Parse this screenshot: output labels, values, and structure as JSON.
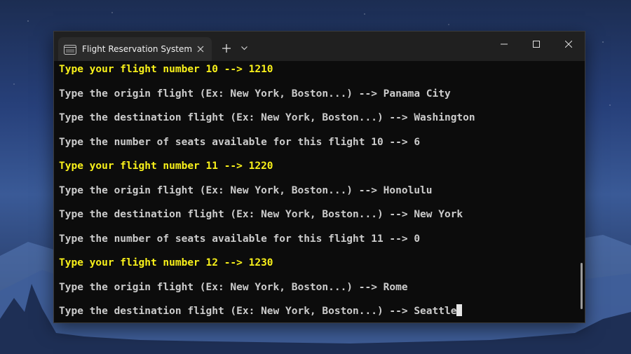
{
  "window": {
    "tab_title": "Flight Reservation System",
    "tab_icon": "terminal-icon",
    "close_tab_icon": "close-icon",
    "new_tab_icon": "plus-icon",
    "dropdown_icon": "chevron-down-icon",
    "controls": [
      "minimize-icon",
      "maximize-icon",
      "close-icon"
    ]
  },
  "console": {
    "lines": [
      {
        "text": "Type your flight number 10 --> 1210",
        "color": "#f9f11a"
      },
      {
        "text": "Type the origin flight (Ex: New York, Boston...) --> Panama City",
        "color": "#cccccc"
      },
      {
        "text": "Type the destination flight (Ex: New York, Boston...) --> Washington",
        "color": "#cccccc"
      },
      {
        "text": "Type the number of seats available for this flight 10 --> 6",
        "color": "#cccccc"
      },
      {
        "text": "Type your flight number 11 --> 1220",
        "color": "#f9f11a"
      },
      {
        "text": "Type the origin flight (Ex: New York, Boston...) --> Honolulu",
        "color": "#cccccc"
      },
      {
        "text": "Type the destination flight (Ex: New York, Boston...) --> New York",
        "color": "#cccccc"
      },
      {
        "text": "Type the number of seats available for this flight 11 --> 0",
        "color": "#cccccc"
      },
      {
        "text": "Type your flight number 12 --> 1230",
        "color": "#f9f11a"
      },
      {
        "text": "Type the origin flight (Ex: New York, Boston...) --> Rome",
        "color": "#cccccc"
      },
      {
        "text": "Type the destination flight (Ex: New York, Boston...) --> Seattle",
        "color": "#cccccc"
      }
    ]
  },
  "colors": {
    "prompt_highlight": "#f9f11a",
    "text": "#cccccc",
    "background": "#0c0c0c"
  }
}
